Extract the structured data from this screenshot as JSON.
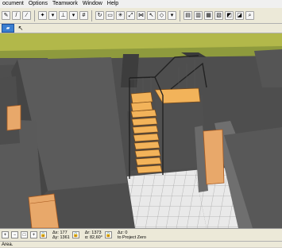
{
  "menu": [
    "ocument",
    "Options",
    "Teamwork",
    "Window",
    "Help"
  ],
  "infobox": {
    "dx": "Δx: 177",
    "dy": "Δy: 1361",
    "dr": "Δr: 1373",
    "angle": "α: 82,60°",
    "dz": "Δz: 0",
    "project_zero": "to Project Zero"
  },
  "status": "Area."
}
